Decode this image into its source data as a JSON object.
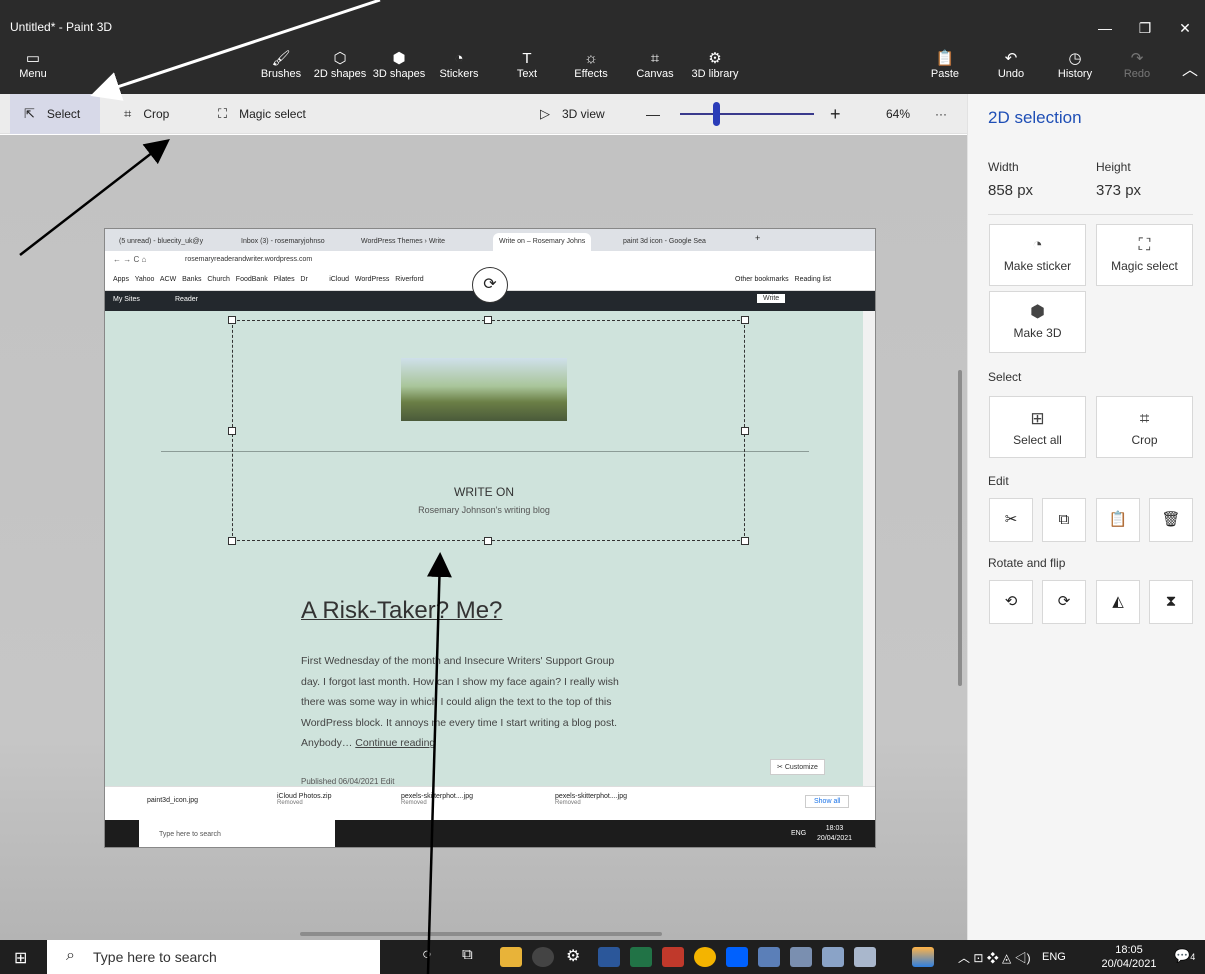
{
  "app": {
    "window_title": "Untitled* - Paint 3D",
    "window_controls": [
      "—",
      "❐",
      "✕"
    ]
  },
  "ribbon": {
    "menu": {
      "label": "Menu",
      "icon": "folder-icon"
    },
    "tools": [
      {
        "id": "brushes",
        "label": "Brushes",
        "icon": "brush-icon"
      },
      {
        "id": "2d-shapes",
        "label": "2D shapes",
        "icon": "2d-shapes-icon"
      },
      {
        "id": "3d-shapes",
        "label": "3D shapes",
        "icon": "3d-shapes-icon"
      },
      {
        "id": "stickers",
        "label": "Stickers",
        "icon": "sticker-icon"
      },
      {
        "id": "text",
        "label": "Text",
        "icon": "text-icon"
      },
      {
        "id": "effects",
        "label": "Effects",
        "icon": "effects-icon"
      },
      {
        "id": "canvas",
        "label": "Canvas",
        "icon": "canvas-icon"
      },
      {
        "id": "3d-library",
        "label": "3D library",
        "icon": "3d-library-icon"
      }
    ],
    "right": [
      {
        "id": "paste",
        "label": "Paste",
        "icon": "paste-icon",
        "enabled": true
      },
      {
        "id": "undo",
        "label": "Undo",
        "icon": "undo-icon",
        "enabled": true
      },
      {
        "id": "history",
        "label": "History",
        "icon": "history-icon",
        "enabled": true
      },
      {
        "id": "redo",
        "label": "Redo",
        "icon": "redo-icon",
        "enabled": false
      }
    ]
  },
  "toolbar": {
    "select": "Select",
    "crop": "Crop",
    "magic_select": "Magic select",
    "view_3d": "3D view",
    "zoom_minus": "—",
    "zoom_plus": "+",
    "zoom_level": "64%",
    "more": "···",
    "zoom_fraction": 0.27
  },
  "panel": {
    "title": "2D selection",
    "width_label": "Width",
    "width_value": "858 px",
    "height_label": "Height",
    "height_value": "373 px",
    "make_sticker": "Make sticker",
    "magic_select": "Magic select",
    "make_3d": "Make 3D",
    "select_heading": "Select",
    "select_all": "Select all",
    "crop": "Crop",
    "edit_heading": "Edit",
    "edit_icons": [
      "cut-icon",
      "copy-icon",
      "paste-icon",
      "delete-icon"
    ],
    "rotate_heading": "Rotate and flip",
    "rotate_icons": [
      "rotate-left-icon",
      "rotate-right-icon",
      "flip-horizontal-icon",
      "flip-vertical-icon"
    ]
  },
  "screenshot": {
    "tabs": [
      "(5 unread) - bluecity_uk@y",
      "Inbox (3) - rosemaryjohnso",
      "WordPress Themes › Write",
      "Write on – Rosemary Johns",
      "paint 3d icon - Google Sea"
    ],
    "url": "rosemaryreaderandwriter.wordpress.com",
    "bookmarks": [
      "Apps",
      "Yahoo",
      "ACW",
      "Banks",
      "Church",
      "FoodBank",
      "Pilates",
      "Dr",
      "iCloud",
      "WordPress",
      "Riverford"
    ],
    "bookmarks_right": [
      "Other bookmarks",
      "Reading list"
    ],
    "wp_mysites": "My Sites",
    "wp_reader": "Reader",
    "wp_write": "Write",
    "site_title": "WRITE ON",
    "site_tagline": "Rosemary Johnson's writing blog",
    "post_title": "A Risk-Taker? Me?",
    "post_body": [
      "First Wednesday of the month and Insecure Writers' Support Group",
      "day. I forgot last month. How can I show my face again? I really wish",
      "there was some way in which I could align the text to the top of this",
      "WordPress block. It annoys me every time I start writing a blog post.",
      "Anybody…"
    ],
    "continue": "Continue reading",
    "published": "Published 06/04/2021",
    "edit": "Edit",
    "customize": "Customize",
    "downloads": [
      {
        "name": "paint3d_icon.jpg",
        "status": ""
      },
      {
        "name": "iCloud Photos.zip",
        "status": "Removed"
      },
      {
        "name": "pexels-skitterphot....jpg",
        "status": "Removed"
      },
      {
        "name": "pexels-skitterphot....jpg",
        "status": "Removed"
      }
    ],
    "show_all": "Show all",
    "taskbar_search": "Type here to search",
    "taskbar_lang": "ENG",
    "taskbar_time": "18:03",
    "taskbar_date": "20/04/2021"
  },
  "taskbar": {
    "search_placeholder": "Type here to search",
    "lang": "ENG",
    "time": "18:05",
    "date": "20/04/2021",
    "notifications": "4"
  }
}
